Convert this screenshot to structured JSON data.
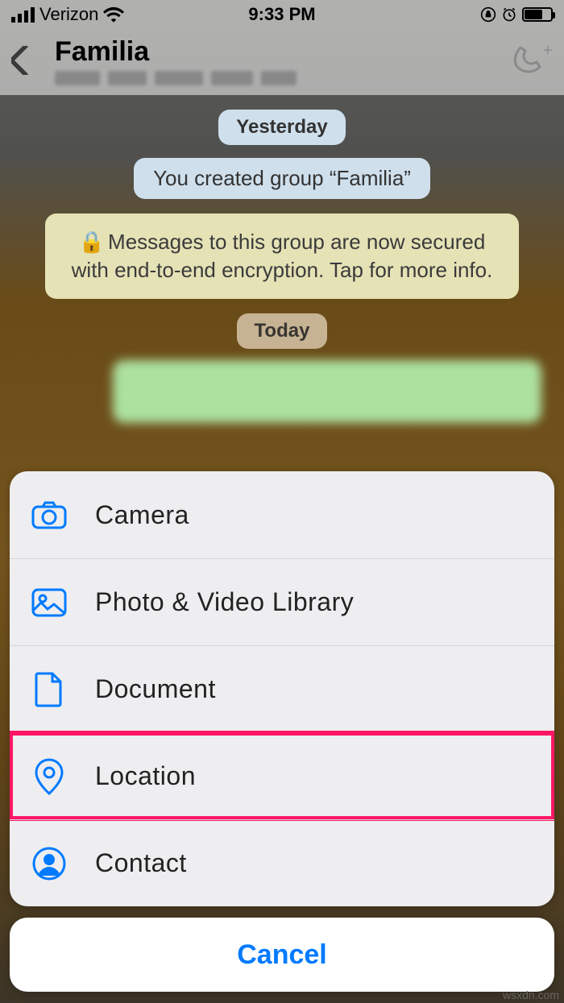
{
  "status": {
    "carrier": "Verizon",
    "time": "9:33 PM"
  },
  "header": {
    "title": "Familia"
  },
  "chat": {
    "day_label_1": "Yesterday",
    "system_msg": "You created group “Familia”",
    "encryption_msg": "Messages to this group are now secured with end-to-end encryption. Tap for more info.",
    "day_label_2": "Today"
  },
  "action_sheet": {
    "items": [
      {
        "label": "Camera"
      },
      {
        "label": "Photo & Video Library"
      },
      {
        "label": "Document"
      },
      {
        "label": "Location"
      },
      {
        "label": "Contact"
      }
    ],
    "cancel": "Cancel"
  },
  "watermark": "wsxdn.com"
}
